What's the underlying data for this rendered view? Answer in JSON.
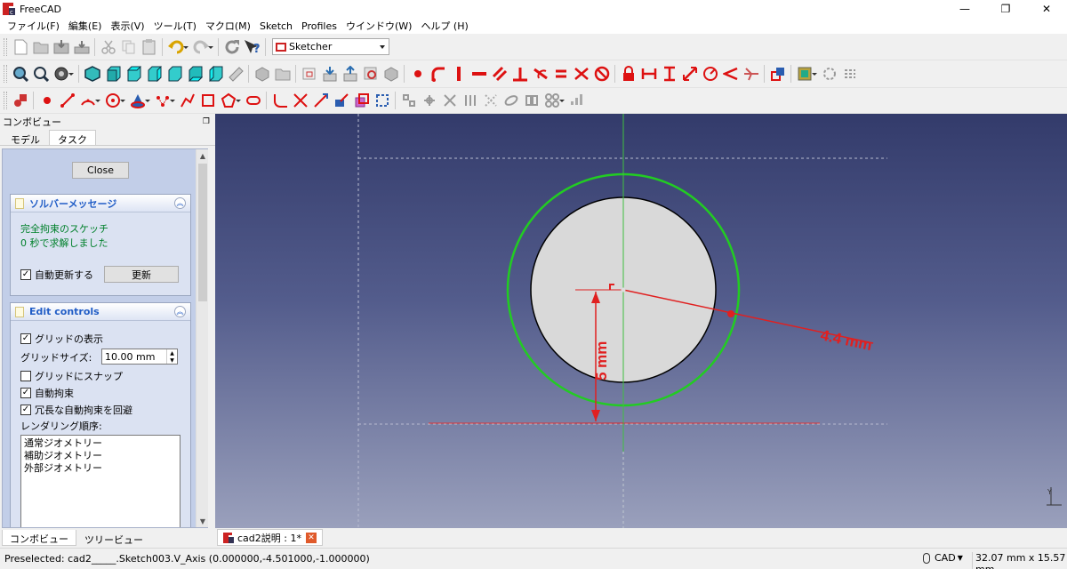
{
  "window": {
    "title": "FreeCAD"
  },
  "menu": [
    "ファイル(F)",
    "編集(E)",
    "表示(V)",
    "ツール(T)",
    "マクロ(M)",
    "Sketch",
    "Profiles",
    "ウインドウ(W)",
    "ヘルプ (H)"
  ],
  "workbench": {
    "selected": "Sketcher"
  },
  "combo": {
    "header": "コンボビュー",
    "tabs": [
      "モデル",
      "タスク"
    ],
    "close_label": "Close",
    "solver": {
      "title": "ソルバーメッセージ",
      "message1": "完全拘束のスケッチ",
      "message2": "0 秒で求解しました",
      "auto_update_label": "自動更新する",
      "update_button": "更新"
    },
    "edit_controls": {
      "title": "Edit controls",
      "show_grid": "グリッドの表示",
      "grid_size_label": "グリッドサイズ:",
      "grid_size_value": "10.00 mm",
      "snap_grid": "グリッドにスナップ",
      "auto_constraints": "自動拘束",
      "avoid_redundant": "冗長な自動拘束を回避",
      "render_order_label": "レンダリング順序:",
      "render_order": [
        "通常ジオメトリー",
        "補助ジオメトリー",
        "外部ジオメトリー"
      ]
    },
    "bottom_tabs": [
      "コンボビュー",
      "ツリービュー"
    ]
  },
  "view": {
    "radius_label": "4.4 mm",
    "distance_label": "5 mm",
    "axis_label": "Y",
    "colors": {
      "circle_outer": "#22cc22",
      "circle_inner_fill": "#d9d9d9",
      "constraint": "#e02020",
      "axis": "#40c040"
    }
  },
  "document_tab": {
    "label": "cad2説明 : 1*"
  },
  "status": {
    "preselected": "Preselected: cad2_____.Sketch003.V_Axis (0.000000,-4.501000,-1.000000)",
    "nav_style": "CAD",
    "dimensions": "32.07 mm x 15.57 mm"
  }
}
